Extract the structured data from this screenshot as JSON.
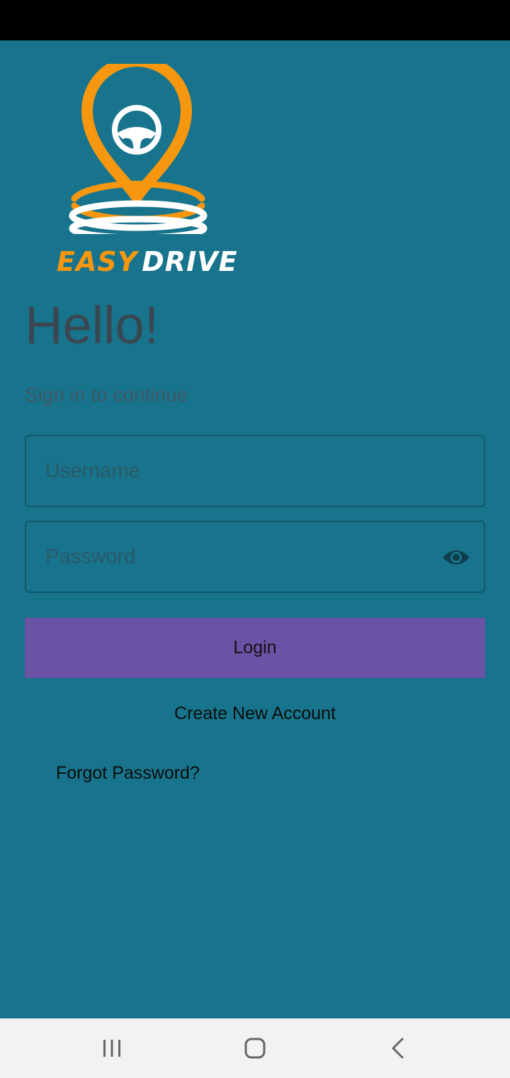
{
  "colors": {
    "background": "#17748c",
    "logo_orange": "#f6970f",
    "logo_white": "#ffffff",
    "button": "#6a52a5",
    "field_border": "#11586b"
  },
  "logo": {
    "word_easy": "EASY",
    "word_drive": "DRIVE",
    "icon": "map-pin-steering-wheel-icon"
  },
  "header": {
    "title": "Hello!",
    "subtitle": "Sign in to continue"
  },
  "form": {
    "username": {
      "placeholder": "Username",
      "value": ""
    },
    "password": {
      "placeholder": "Password",
      "value": "",
      "toggle_icon": "eye-icon"
    },
    "login_label": "Login",
    "create_account_label": "Create New Account",
    "forgot_password_label": "Forgot Password?"
  },
  "nav": {
    "icons": [
      "recents-icon",
      "home-icon",
      "back-icon"
    ]
  }
}
